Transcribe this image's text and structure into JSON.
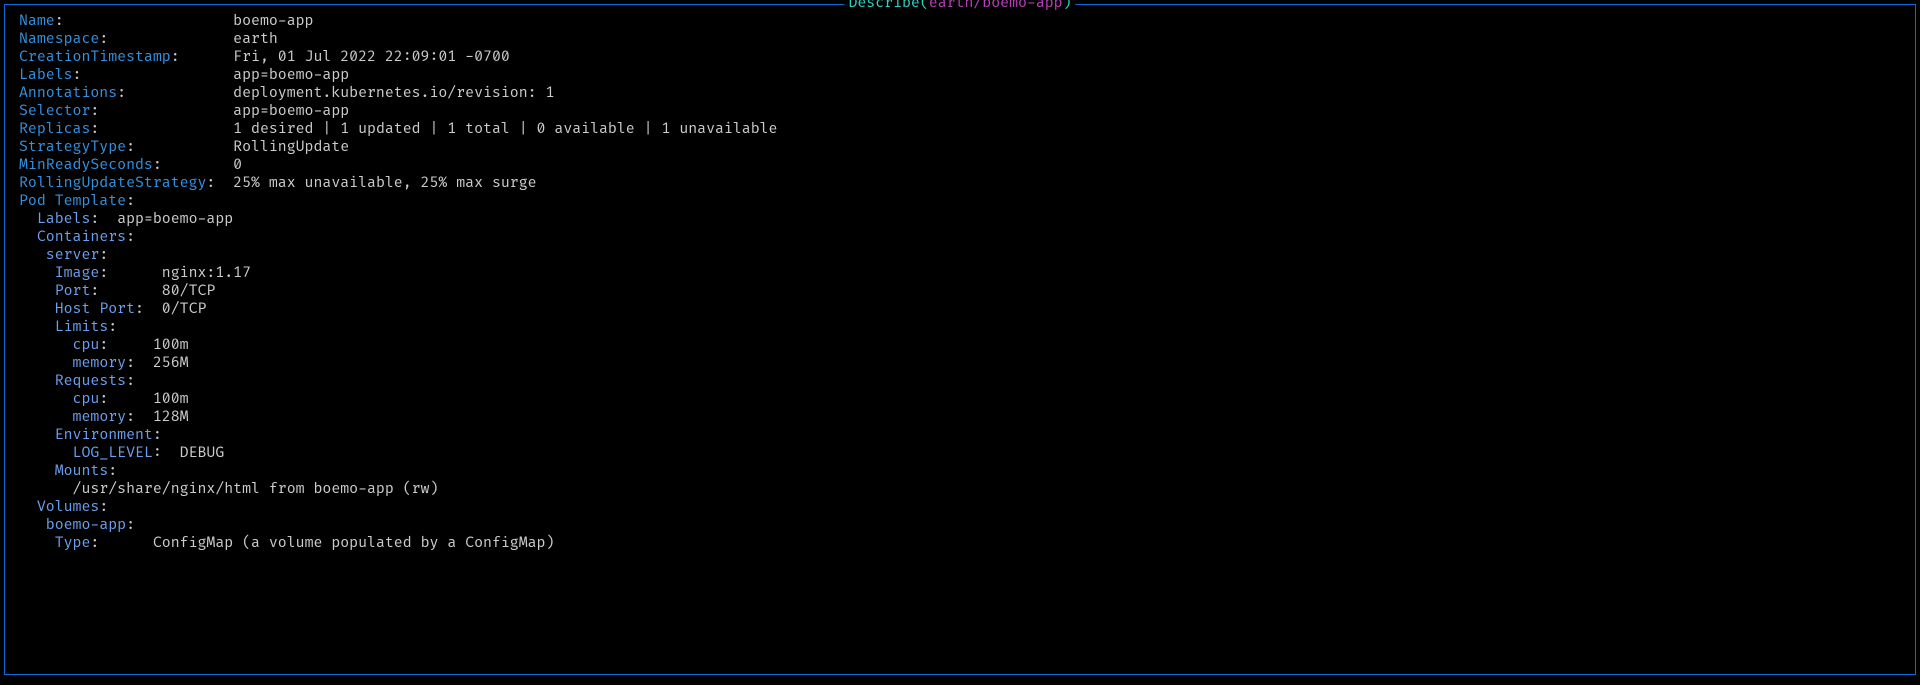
{
  "title": {
    "action": "Describe",
    "lparen": "(",
    "ref": "earth/boemo-app",
    "rparen": ")"
  },
  "fields": {
    "name": {
      "key": "Name",
      "val": "boemo-app"
    },
    "namespace": {
      "key": "Namespace",
      "val": "earth"
    },
    "creation": {
      "key": "CreationTimestamp",
      "val": "Fri, 01 Jul 2022 22:09:01 -0700"
    },
    "labels": {
      "key": "Labels",
      "val": "app=boemo-app"
    },
    "annotations": {
      "key": "Annotations",
      "val": "deployment.kubernetes.io/revision: 1"
    },
    "selector": {
      "key": "Selector",
      "val": "app=boemo-app"
    },
    "replicas": {
      "key": "Replicas",
      "val": "1 desired | 1 updated | 1 total | 0 available | 1 unavailable"
    },
    "strategy": {
      "key": "StrategyType",
      "val": "RollingUpdate"
    },
    "minready": {
      "key": "MinReadySeconds",
      "val": "0"
    },
    "rollstrat": {
      "key": "RollingUpdateStrategy",
      "val": "25% max unavailable, 25% max surge"
    }
  },
  "pod": {
    "header": "Pod Template",
    "labels": {
      "key": "Labels",
      "val": "app=boemo-app"
    },
    "containers": "Containers",
    "container_name": "server",
    "image": {
      "key": "Image",
      "val": "nginx:1.17"
    },
    "port": {
      "key": "Port",
      "val": "80/TCP"
    },
    "hostport": {
      "key": "Host Port",
      "val": "0/TCP"
    },
    "limits": "Limits",
    "limits_cpu": {
      "key": "cpu",
      "val": "100m"
    },
    "limits_mem": {
      "key": "memory",
      "val": "256M"
    },
    "requests": "Requests",
    "req_cpu": {
      "key": "cpu",
      "val": "100m"
    },
    "req_mem": {
      "key": "memory",
      "val": "128M"
    },
    "env": "Environment",
    "env_log": {
      "key": "LOG_LEVEL",
      "val": "DEBUG"
    },
    "mounts": "Mounts",
    "mount_path": "/usr/share/nginx/html from boemo-app (rw)",
    "volumes": "Volumes",
    "vol_name": "boemo-app",
    "vol_type": {
      "key": "Type",
      "val": "ConfigMap (a volume populated by a ConfigMap)"
    }
  }
}
